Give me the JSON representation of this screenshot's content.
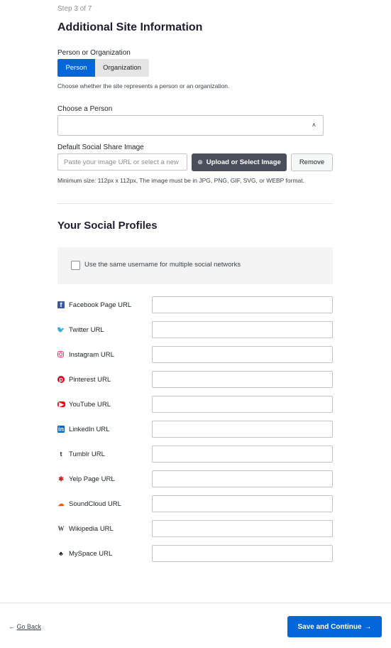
{
  "step": "Step 3 of 7",
  "title": "Additional Site Information",
  "person_org": {
    "label": "Person or Organization",
    "options": [
      "Person",
      "Organization"
    ],
    "selected": "Person",
    "help": "Choose whether the site represents a person or an organization."
  },
  "choose_person": {
    "label": "Choose a Person",
    "value": "",
    "chevron": "˄"
  },
  "share_image": {
    "label": "Default Social Share Image",
    "placeholder": "Paste your image URL or select a new image",
    "upload_label": "Upload or Select Image",
    "upload_icon": "⊕",
    "remove_label": "Remove",
    "help": "Minimum size: 112px x 112px, The image must be in JPG, PNG, GIF, SVG, or WEBP format."
  },
  "social": {
    "title": "Your Social Profiles",
    "same_username_label": "Use the same username for multiple social networks",
    "same_username_checked": false,
    "profiles": [
      {
        "label": "Facebook Page URL",
        "icon": "facebook-icon",
        "glyph": "f",
        "value": ""
      },
      {
        "label": "Twitter URL",
        "icon": "twitter-icon",
        "glyph": "🐦",
        "value": ""
      },
      {
        "label": "Instagram URL",
        "icon": "instagram-icon",
        "glyph": "",
        "value": ""
      },
      {
        "label": "Pinterest URL",
        "icon": "pinterest-icon",
        "glyph": "p",
        "value": ""
      },
      {
        "label": "YouTube URL",
        "icon": "youtube-icon",
        "glyph": "▶",
        "value": ""
      },
      {
        "label": "LinkedIn URL",
        "icon": "linkedin-icon",
        "glyph": "in",
        "value": ""
      },
      {
        "label": "Tumblr URL",
        "icon": "tumblr-icon",
        "glyph": "t",
        "value": ""
      },
      {
        "label": "Yelp Page URL",
        "icon": "yelp-icon",
        "glyph": "✱",
        "value": ""
      },
      {
        "label": "SoundCloud URL",
        "icon": "soundcloud-icon",
        "glyph": "☁",
        "value": ""
      },
      {
        "label": "Wikipedia URL",
        "icon": "wikipedia-icon",
        "glyph": "W",
        "value": ""
      },
      {
        "label": "MySpace URL",
        "icon": "myspace-icon",
        "glyph": "♣",
        "value": ""
      }
    ]
  },
  "footer": {
    "back_arrow": "←",
    "back_label": "Go Back",
    "save_label": "Save and Continue",
    "save_arrow": "→"
  },
  "colors": {
    "primary": "#0066d9",
    "dark_button": "#4a4f5c"
  }
}
